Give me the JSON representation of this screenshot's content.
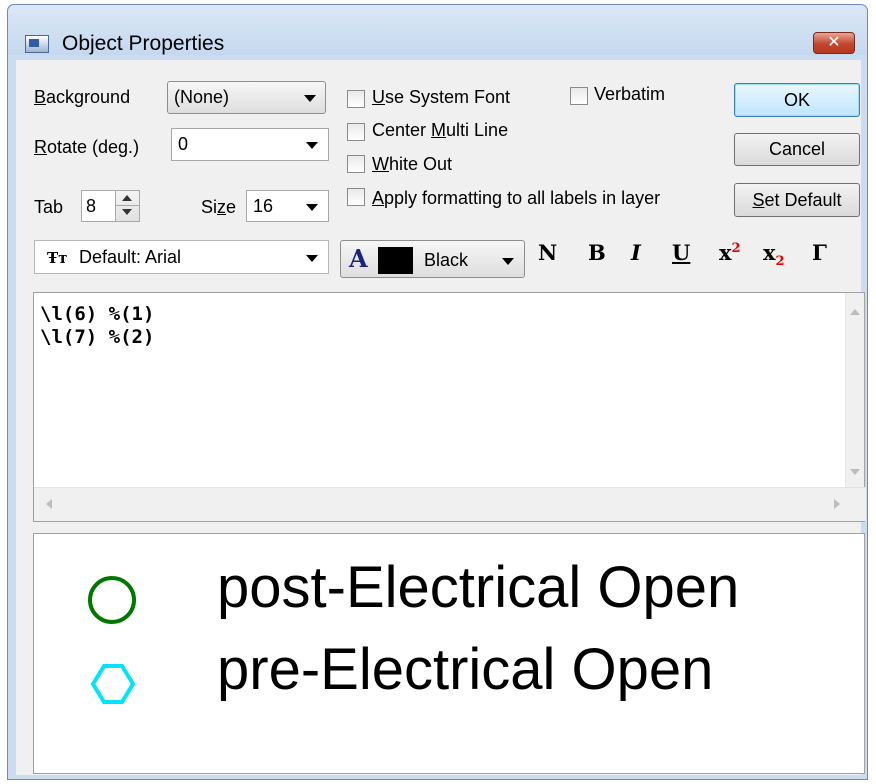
{
  "window": {
    "title": "Object Properties"
  },
  "background": {
    "label": "Background",
    "value": "(None)"
  },
  "rotate": {
    "label": "Rotate (deg.)",
    "value": "0"
  },
  "tab": {
    "label": "Tab",
    "value": "8"
  },
  "size": {
    "label": "Size",
    "value": "16"
  },
  "checkboxes": {
    "use_system_font": {
      "label": "Use System Font",
      "checked": false
    },
    "verbatim": {
      "label": "Verbatim",
      "checked": false
    },
    "center_multi_line": {
      "label": "Center Multi Line",
      "checked": false
    },
    "white_out": {
      "label": "White Out",
      "checked": false
    },
    "apply_all": {
      "label": "Apply formatting to all labels in layer",
      "checked": false
    }
  },
  "buttons": {
    "ok": "OK",
    "cancel": "Cancel",
    "set_default": "Set Default"
  },
  "font": {
    "value": "Default: Arial"
  },
  "color": {
    "value": "Black",
    "swatch": "#000000"
  },
  "format_buttons": {
    "normal": "N",
    "bold": "B",
    "italic": "I",
    "underline": "U",
    "superscript_base": "x",
    "superscript_exp": "2",
    "subscript_base": "x",
    "subscript_exp": "2",
    "greek": "Γ"
  },
  "editor": {
    "lines": [
      "\\l(6) %(1)",
      "\\l(7) %(2)"
    ]
  },
  "preview": {
    "entries": [
      {
        "label": "post-Electrical Open",
        "symbol": "circle-icon",
        "color": "#007700"
      },
      {
        "label": "pre-Electrical Open",
        "symbol": "hexagon-icon",
        "color": "#00e5ff"
      }
    ]
  }
}
